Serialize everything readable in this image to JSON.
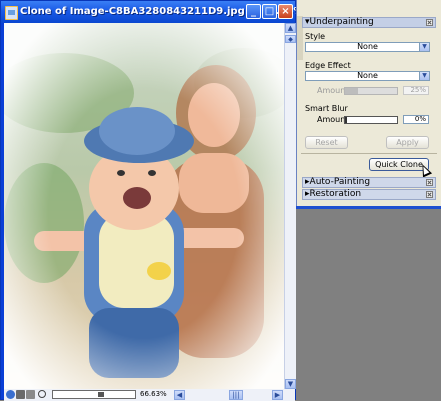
{
  "image_window": {
    "title": "Clone of Image-C8BA3280843211D9.jpg @ 66.63%",
    "minimize_label": "_",
    "maximize_label": "□",
    "close_label": "×",
    "zoom_text": "66.63%"
  },
  "palette": {
    "sections": {
      "underpainting": "Underpainting",
      "auto_painting": "Auto-Painting",
      "restoration": "Restoration"
    },
    "style_label": "Style",
    "style_value": "None",
    "edge_effect_label": "Edge Effect",
    "edge_effect_value": "None",
    "edge_amount_label": "Amount",
    "edge_amount_value": "25%",
    "edge_amount_fraction": 0.25,
    "smart_blur_label": "Smart Blur",
    "blur_amount_label": "Amount",
    "blur_amount_value": "0%",
    "blur_amount_fraction": 0.0,
    "reset_label": "Reset",
    "apply_label": "Apply",
    "quick_clone_label": "Quick Clone"
  },
  "colors": {
    "xp_titlebar": "#1a5ae6",
    "panel_bg": "#ece9d8",
    "desktop": "#808080"
  }
}
